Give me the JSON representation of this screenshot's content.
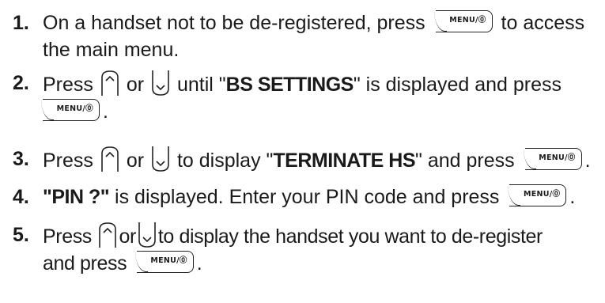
{
  "key_label": "MENU/⓪",
  "steps": [
    {
      "num": "1.",
      "a": "On a handset not to be de-registered, press",
      "b": "to access the main menu."
    },
    {
      "num": "2.",
      "a": "Press",
      "b": "or",
      "c": "until \"",
      "bold": "BS SETTINGS",
      "d": "\" is displayed and press"
    },
    {
      "num": "3.",
      "a": "Press",
      "b": "or",
      "c": "to display \"",
      "bold": "TERMINATE HS",
      "d": "\" and press"
    },
    {
      "num": "4.",
      "bold": "\"PIN ?\"",
      "a": " is displayed. Enter your PIN code and press"
    },
    {
      "num": "5.",
      "a": "Press",
      "b": "or",
      "c": "to display the handset you want to de-register",
      "d": "and press"
    }
  ]
}
